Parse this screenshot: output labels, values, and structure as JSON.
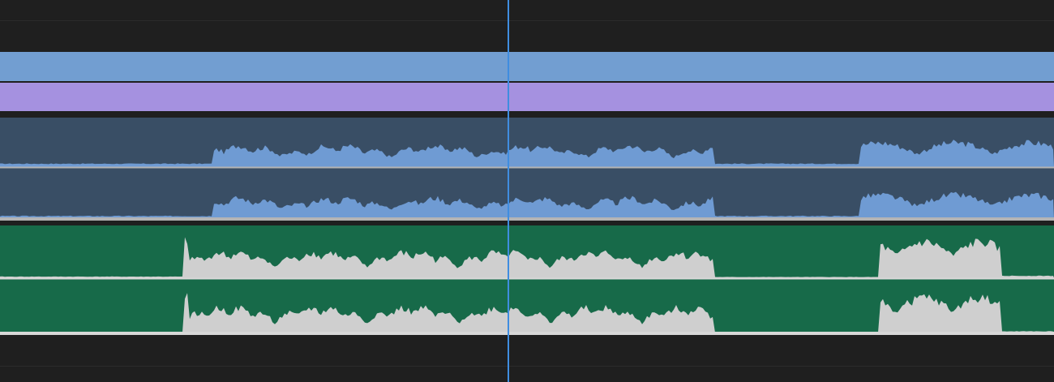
{
  "timeline": {
    "tracks": [
      {
        "id": "video-clip-blue",
        "kind": "video",
        "color": "#729ed1"
      },
      {
        "id": "video-clip-purple",
        "kind": "video",
        "color": "#a591e0"
      },
      {
        "id": "audio-clip-1",
        "kind": "audio-stereo",
        "color": "#394e65",
        "waveform_color": "#6f9bd3",
        "divider_color": "#b4b4b4"
      },
      {
        "id": "audio-clip-2",
        "kind": "audio-stereo",
        "color": "#176a49",
        "waveform_color": "#cfcfcf",
        "divider_color": "#d8d8d8"
      }
    ],
    "playhead": {
      "color": "#3f8de0"
    },
    "background_color": "#1f1f1f"
  }
}
